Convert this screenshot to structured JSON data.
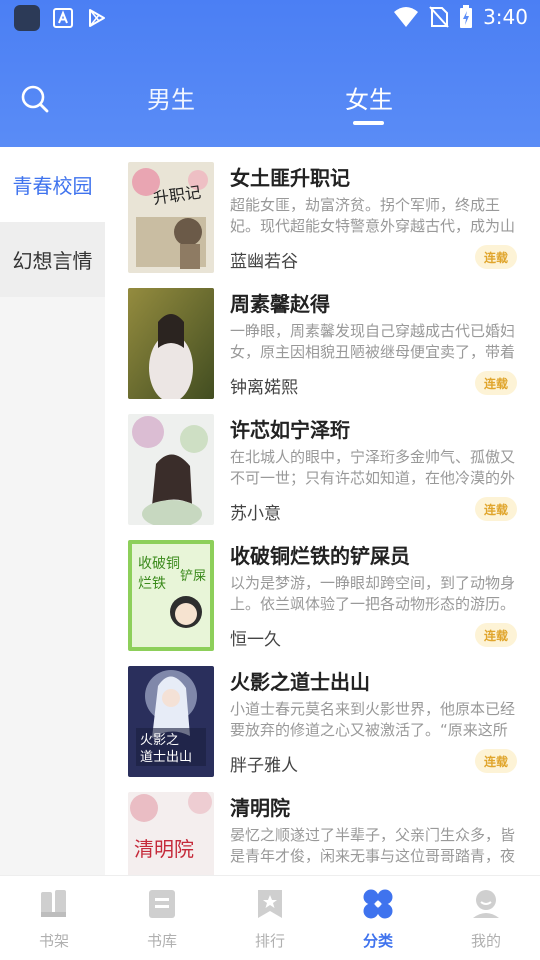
{
  "status_bar": {
    "time": "3:40"
  },
  "header": {
    "tabs": [
      {
        "label": "男生"
      },
      {
        "label": "女生"
      }
    ],
    "active_tab": "女生"
  },
  "side_menu": {
    "items": [
      {
        "label": "青春校园"
      },
      {
        "label": "幻想言情"
      }
    ],
    "active": "青春校园"
  },
  "books": [
    {
      "title": "女土匪升职记",
      "desc": "超能女匪，劫富济贫。拐个军师，终成王妃。现代超能女特警意外穿越古代，成为山",
      "author": "蓝幽若谷",
      "status": "连载",
      "cover_text": "升职记"
    },
    {
      "title": "周素馨赵得",
      "desc": "一睁眼，周素馨发现自己穿越成古代已婚妇女，原主因相貌丑陋被继母便宜卖了，带着",
      "author": "钟离婼熙",
      "status": "连载",
      "cover_text": ""
    },
    {
      "title": "许芯如宁泽珩",
      "desc": "在北城人的眼中，宁泽珩多金帅气、孤傲又不可一世；只有许芯如知道，在他冷漠的外",
      "author": "苏小意",
      "status": "连载",
      "cover_text": ""
    },
    {
      "title": "收破铜烂铁的铲屎员",
      "desc": "以为是梦游，一睁眼却跨空间，到了动物身上。依兰飒体验了一把各动物形态的游历。",
      "author": "恒一久",
      "status": "连载",
      "cover_text": "收破铜烂铁的铲屎员"
    },
    {
      "title": "火影之道士出山",
      "desc": "小道士春元莫名来到火影世界，他原本已经要放弃的修道之心又被激活了。“原来这所谓",
      "author": "胖子雅人",
      "status": "连载",
      "cover_text": "火影之道士出山"
    },
    {
      "title": "清明院",
      "desc": "晏忆之顺遂过了半辈子，父亲门生众多，皆是青年才俊，闲来无事与这位哥哥踏青，夜",
      "author": "",
      "status": "",
      "cover_text": "清明院"
    }
  ],
  "bottom_nav": {
    "items": [
      {
        "label": "书架",
        "icon": "bookshelf-icon"
      },
      {
        "label": "书库",
        "icon": "library-icon"
      },
      {
        "label": "排行",
        "icon": "ranking-icon"
      },
      {
        "label": "分类",
        "icon": "category-icon"
      },
      {
        "label": "我的",
        "icon": "profile-icon"
      }
    ],
    "active": "分类",
    "active_color": "#3f73ee",
    "inactive_color": "#cfcfcf"
  },
  "colors": {
    "header_blue": "#4b7ff4",
    "accent": "#3f73ee",
    "badge_text": "#e0a52c",
    "badge_bg": "#fdf3d6"
  }
}
